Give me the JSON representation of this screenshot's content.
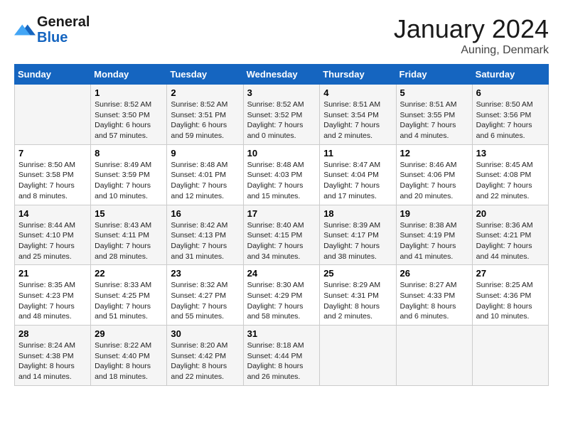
{
  "header": {
    "logo_line1": "General",
    "logo_line2": "Blue",
    "month": "January 2024",
    "location": "Auning, Denmark"
  },
  "days_of_week": [
    "Sunday",
    "Monday",
    "Tuesday",
    "Wednesday",
    "Thursday",
    "Friday",
    "Saturday"
  ],
  "weeks": [
    [
      {
        "day": "",
        "info": ""
      },
      {
        "day": "1",
        "info": "Sunrise: 8:52 AM\nSunset: 3:50 PM\nDaylight: 6 hours\nand 57 minutes."
      },
      {
        "day": "2",
        "info": "Sunrise: 8:52 AM\nSunset: 3:51 PM\nDaylight: 6 hours\nand 59 minutes."
      },
      {
        "day": "3",
        "info": "Sunrise: 8:52 AM\nSunset: 3:52 PM\nDaylight: 7 hours\nand 0 minutes."
      },
      {
        "day": "4",
        "info": "Sunrise: 8:51 AM\nSunset: 3:54 PM\nDaylight: 7 hours\nand 2 minutes."
      },
      {
        "day": "5",
        "info": "Sunrise: 8:51 AM\nSunset: 3:55 PM\nDaylight: 7 hours\nand 4 minutes."
      },
      {
        "day": "6",
        "info": "Sunrise: 8:50 AM\nSunset: 3:56 PM\nDaylight: 7 hours\nand 6 minutes."
      }
    ],
    [
      {
        "day": "7",
        "info": "Sunrise: 8:50 AM\nSunset: 3:58 PM\nDaylight: 7 hours\nand 8 minutes."
      },
      {
        "day": "8",
        "info": "Sunrise: 8:49 AM\nSunset: 3:59 PM\nDaylight: 7 hours\nand 10 minutes."
      },
      {
        "day": "9",
        "info": "Sunrise: 8:48 AM\nSunset: 4:01 PM\nDaylight: 7 hours\nand 12 minutes."
      },
      {
        "day": "10",
        "info": "Sunrise: 8:48 AM\nSunset: 4:03 PM\nDaylight: 7 hours\nand 15 minutes."
      },
      {
        "day": "11",
        "info": "Sunrise: 8:47 AM\nSunset: 4:04 PM\nDaylight: 7 hours\nand 17 minutes."
      },
      {
        "day": "12",
        "info": "Sunrise: 8:46 AM\nSunset: 4:06 PM\nDaylight: 7 hours\nand 20 minutes."
      },
      {
        "day": "13",
        "info": "Sunrise: 8:45 AM\nSunset: 4:08 PM\nDaylight: 7 hours\nand 22 minutes."
      }
    ],
    [
      {
        "day": "14",
        "info": "Sunrise: 8:44 AM\nSunset: 4:10 PM\nDaylight: 7 hours\nand 25 minutes."
      },
      {
        "day": "15",
        "info": "Sunrise: 8:43 AM\nSunset: 4:11 PM\nDaylight: 7 hours\nand 28 minutes."
      },
      {
        "day": "16",
        "info": "Sunrise: 8:42 AM\nSunset: 4:13 PM\nDaylight: 7 hours\nand 31 minutes."
      },
      {
        "day": "17",
        "info": "Sunrise: 8:40 AM\nSunset: 4:15 PM\nDaylight: 7 hours\nand 34 minutes."
      },
      {
        "day": "18",
        "info": "Sunrise: 8:39 AM\nSunset: 4:17 PM\nDaylight: 7 hours\nand 38 minutes."
      },
      {
        "day": "19",
        "info": "Sunrise: 8:38 AM\nSunset: 4:19 PM\nDaylight: 7 hours\nand 41 minutes."
      },
      {
        "day": "20",
        "info": "Sunrise: 8:36 AM\nSunset: 4:21 PM\nDaylight: 7 hours\nand 44 minutes."
      }
    ],
    [
      {
        "day": "21",
        "info": "Sunrise: 8:35 AM\nSunset: 4:23 PM\nDaylight: 7 hours\nand 48 minutes."
      },
      {
        "day": "22",
        "info": "Sunrise: 8:33 AM\nSunset: 4:25 PM\nDaylight: 7 hours\nand 51 minutes."
      },
      {
        "day": "23",
        "info": "Sunrise: 8:32 AM\nSunset: 4:27 PM\nDaylight: 7 hours\nand 55 minutes."
      },
      {
        "day": "24",
        "info": "Sunrise: 8:30 AM\nSunset: 4:29 PM\nDaylight: 7 hours\nand 58 minutes."
      },
      {
        "day": "25",
        "info": "Sunrise: 8:29 AM\nSunset: 4:31 PM\nDaylight: 8 hours\nand 2 minutes."
      },
      {
        "day": "26",
        "info": "Sunrise: 8:27 AM\nSunset: 4:33 PM\nDaylight: 8 hours\nand 6 minutes."
      },
      {
        "day": "27",
        "info": "Sunrise: 8:25 AM\nSunset: 4:36 PM\nDaylight: 8 hours\nand 10 minutes."
      }
    ],
    [
      {
        "day": "28",
        "info": "Sunrise: 8:24 AM\nSunset: 4:38 PM\nDaylight: 8 hours\nand 14 minutes."
      },
      {
        "day": "29",
        "info": "Sunrise: 8:22 AM\nSunset: 4:40 PM\nDaylight: 8 hours\nand 18 minutes."
      },
      {
        "day": "30",
        "info": "Sunrise: 8:20 AM\nSunset: 4:42 PM\nDaylight: 8 hours\nand 22 minutes."
      },
      {
        "day": "31",
        "info": "Sunrise: 8:18 AM\nSunset: 4:44 PM\nDaylight: 8 hours\nand 26 minutes."
      },
      {
        "day": "",
        "info": ""
      },
      {
        "day": "",
        "info": ""
      },
      {
        "day": "",
        "info": ""
      }
    ]
  ]
}
